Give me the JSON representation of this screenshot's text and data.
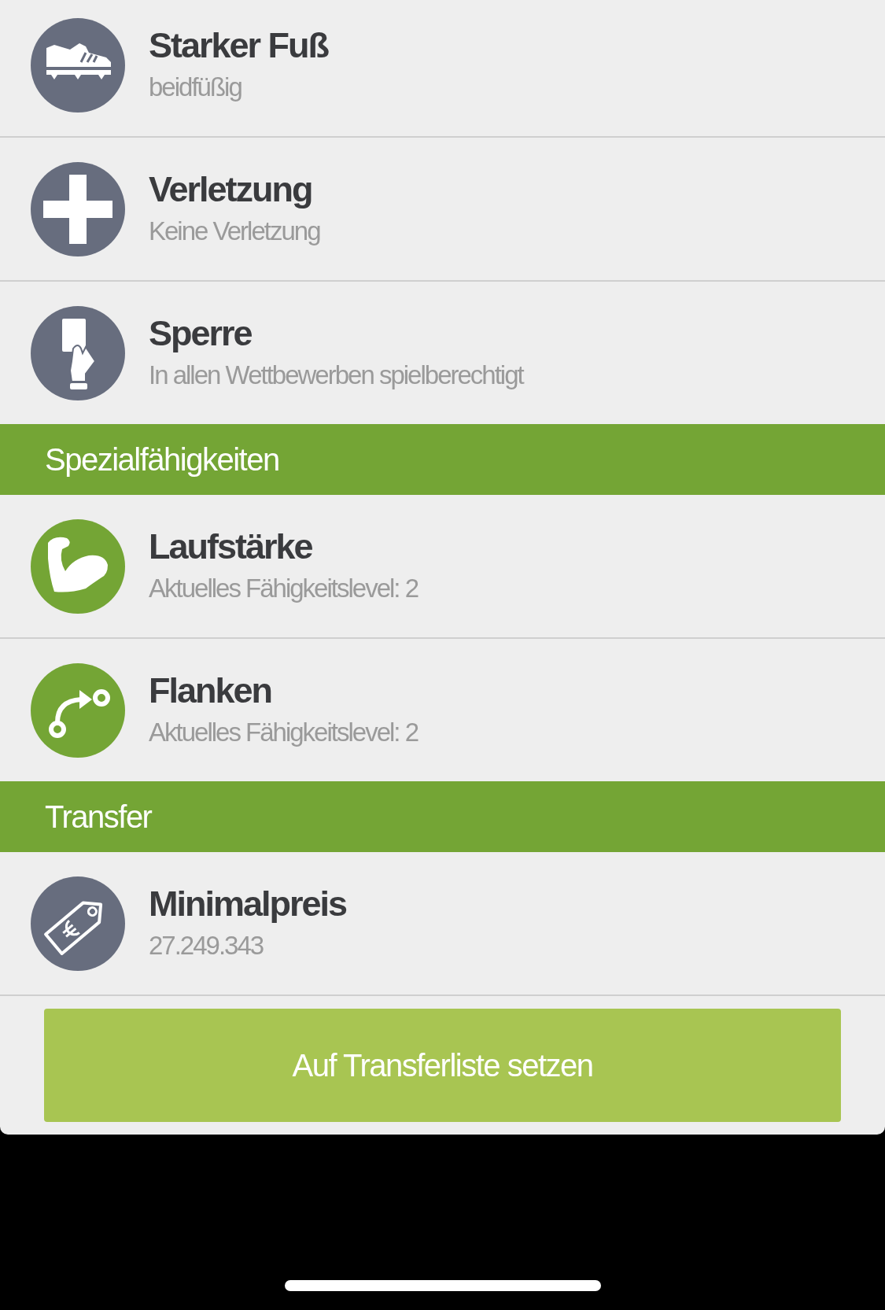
{
  "sections": [
    {
      "rows": [
        {
          "kind": "shoe",
          "color": "#676d7e",
          "title": "Starker Fuß",
          "subtitle": "beidfüßig"
        },
        {
          "kind": "cross",
          "color": "#676d7e",
          "title": "Verletzung",
          "subtitle": "Keine Verletzung"
        },
        {
          "kind": "card",
          "color": "#676d7e",
          "title": "Sperre",
          "subtitle": "In allen Wettbewerben spielberechtigt"
        }
      ]
    },
    {
      "title": "Spezialfähigkeiten",
      "rows": [
        {
          "kind": "muscle",
          "color": "#74a535",
          "title": "Laufstärke",
          "subtitle": "Aktuelles Fähigkeitslevel: 2"
        },
        {
          "kind": "curve",
          "color": "#74a535",
          "title": "Flanken",
          "subtitle": "Aktuelles Fähigkeitslevel: 2"
        }
      ]
    },
    {
      "title": "Transfer",
      "rows": [
        {
          "kind": "tag",
          "color": "#676d7e",
          "title": "Minimalpreis",
          "subtitle": "27.249.343"
        }
      ]
    }
  ],
  "button": {
    "label": "Auf Transferliste setzen"
  }
}
